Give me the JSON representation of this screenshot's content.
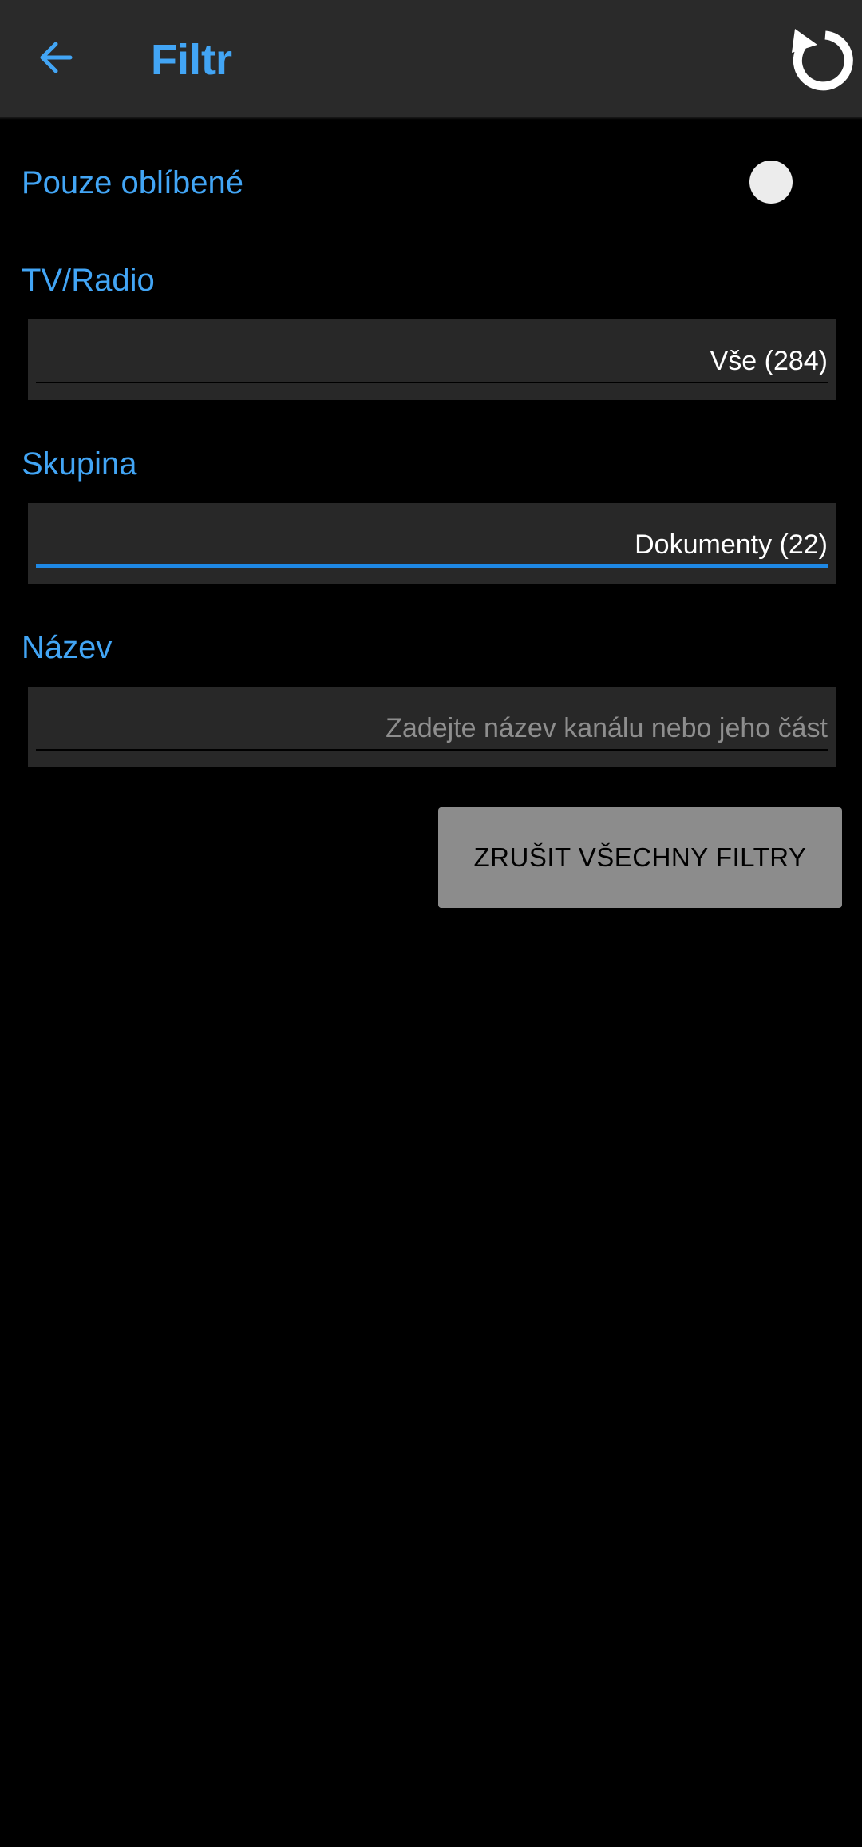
{
  "appbar": {
    "title": "Filtr",
    "back_icon": "arrow-left-icon",
    "reset_icon": "refresh-icon"
  },
  "favorites": {
    "label": "Pouze oblíbené",
    "enabled": false
  },
  "tv_radio": {
    "label": "TV/Radio",
    "value": "Vše (284)"
  },
  "group": {
    "label": "Skupina",
    "value": "Dokumenty (22)"
  },
  "name": {
    "label": "Název",
    "value": "",
    "placeholder": "Zadejte název kanálu nebo jeho část"
  },
  "clear_button": {
    "label": "ZRUŠIT VŠECHNY FILTRY"
  },
  "colors": {
    "accent": "#42a5f5",
    "active_underline": "#1e88e5",
    "appbar_bg": "#2a2a2a",
    "field_bg": "#282828",
    "button_bg": "#8c8c8c"
  }
}
